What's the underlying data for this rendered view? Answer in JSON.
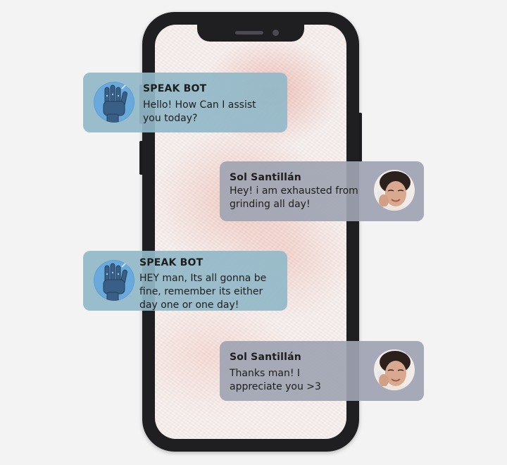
{
  "conversation": {
    "messages": [
      {
        "sender": "SPEAK BOT",
        "role": "bot",
        "text": "Hello! How Can I assist\nyou today?",
        "avatar_icon": "robot-hand-icon"
      },
      {
        "sender": "Sol Santillán",
        "role": "user",
        "text": "Hey! i am exhausted from\ngrinding all day!",
        "avatar_icon": "user-photo-avatar"
      },
      {
        "sender": "SPEAK BOT",
        "role": "bot",
        "text": "HEY man, Its all gonna be\nfine, remember its either\nday one or one day!",
        "avatar_icon": "robot-hand-icon"
      },
      {
        "sender": "Sol Santillán",
        "role": "user",
        "text": "Thanks man!  I\nappreciate you >3",
        "avatar_icon": "user-photo-avatar"
      }
    ]
  },
  "colors": {
    "bot_bubble": "#92b8c8",
    "user_bubble": "#a0a4b2",
    "phone_frame": "#1f1f22",
    "screen_bg": "#f6eeec"
  }
}
